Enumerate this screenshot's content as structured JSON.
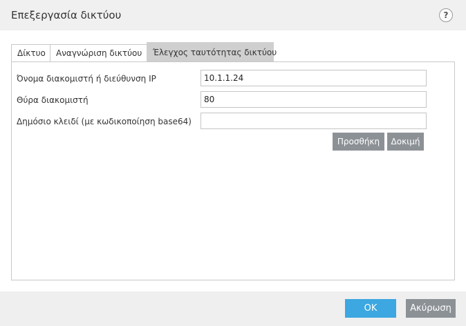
{
  "dialog": {
    "title": "Επεξεργασία δικτύου",
    "help_label": "?"
  },
  "tabs": [
    {
      "label": "Δίκτυο",
      "active": false
    },
    {
      "label": "Αναγνώριση δικτύου",
      "active": false
    },
    {
      "label": "Έλεγχος ταυτότητας δικτύου",
      "active": true
    }
  ],
  "form": {
    "server": {
      "label": "Όνομα διακομιστή ή διεύθυνση IP",
      "value": "10.1.1.24"
    },
    "port": {
      "label": "Θύρα διακομιστή",
      "value": "80"
    },
    "public_key": {
      "label": "Δημόσιο κλειδί (με κωδικοποίηση base64)",
      "value": ""
    },
    "add_label": "Προσθήκη",
    "test_label": "Δοκιμή"
  },
  "footer": {
    "ok_label": "OK",
    "cancel_label": "Ακύρωση"
  },
  "colors": {
    "accent": "#3ca7e0",
    "secondary_button": "#8c9196",
    "active_tab": "#cfcfcf",
    "chrome": "#f0f0f0"
  }
}
